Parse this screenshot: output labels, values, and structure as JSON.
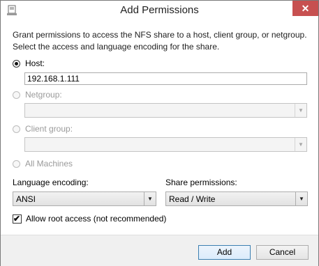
{
  "window": {
    "title": "Add Permissions",
    "icon": "server-share-icon",
    "close_glyph": "✕"
  },
  "description": {
    "line1": "Grant permissions to access the NFS share to a host, client group, or netgroup.",
    "line2": "Select the access and language encoding for the share."
  },
  "options": {
    "host": {
      "label": "Host:",
      "selected": true,
      "value": "192.168.1.111"
    },
    "netgroup": {
      "label": "Netgroup:",
      "enabled": false,
      "value": ""
    },
    "client_group": {
      "label": "Client group:",
      "enabled": false,
      "value": ""
    },
    "all_machines": {
      "label": "All Machines",
      "enabled": false
    }
  },
  "language_encoding": {
    "label": "Language encoding:",
    "value": "ANSI"
  },
  "share_permissions": {
    "label": "Share permissions:",
    "value": "Read / Write"
  },
  "allow_root": {
    "label": "Allow root access (not recommended)",
    "checked": true
  },
  "buttons": {
    "add": "Add",
    "cancel": "Cancel"
  },
  "colors": {
    "close_bg": "#c75050",
    "primary_border": "#3c7fb1"
  }
}
